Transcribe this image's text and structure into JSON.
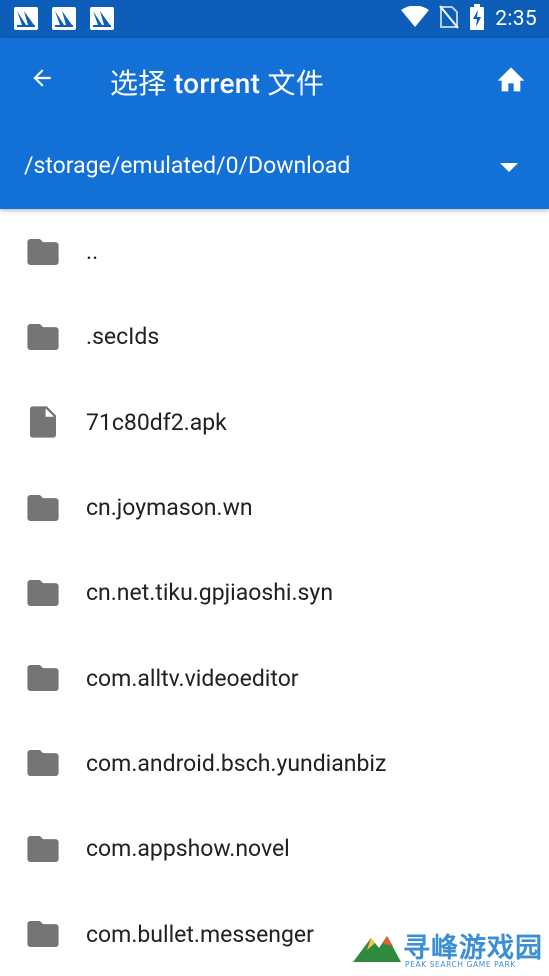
{
  "status_bar": {
    "time": "2:35",
    "notification_icons": [
      "notification-app-icon",
      "notification-app-icon",
      "notification-app-icon"
    ],
    "icons": [
      "wifi-icon",
      "no-sim-icon",
      "battery-charging-icon"
    ]
  },
  "app_bar": {
    "title": "选择 torrent 文件",
    "back_icon": "arrow-back-icon",
    "home_icon": "home-icon",
    "current_path": "/storage/emulated/0/Download",
    "dropdown_icon": "dropdown-arrow-icon"
  },
  "files": [
    {
      "name": "..",
      "type": "folder"
    },
    {
      "name": ".secIds",
      "type": "folder"
    },
    {
      "name": "71c80df2.apk",
      "type": "file"
    },
    {
      "name": "cn.joymason.wn",
      "type": "folder"
    },
    {
      "name": "cn.net.tiku.gpjiaoshi.syn",
      "type": "folder"
    },
    {
      "name": "com.alltv.videoeditor",
      "type": "folder"
    },
    {
      "name": "com.android.bsch.yundianbiz",
      "type": "folder"
    },
    {
      "name": "com.appshow.novel",
      "type": "folder"
    },
    {
      "name": "com.bullet.messenger",
      "type": "folder"
    }
  ],
  "watermark": {
    "title": "寻峰游戏园",
    "subtitle": "PEAK SEARCH GAME PARK"
  },
  "colors": {
    "status_bar": "#0D5EB8",
    "app_bar": "#1270D6",
    "icon_grey": "#757575",
    "text": "#212121"
  }
}
